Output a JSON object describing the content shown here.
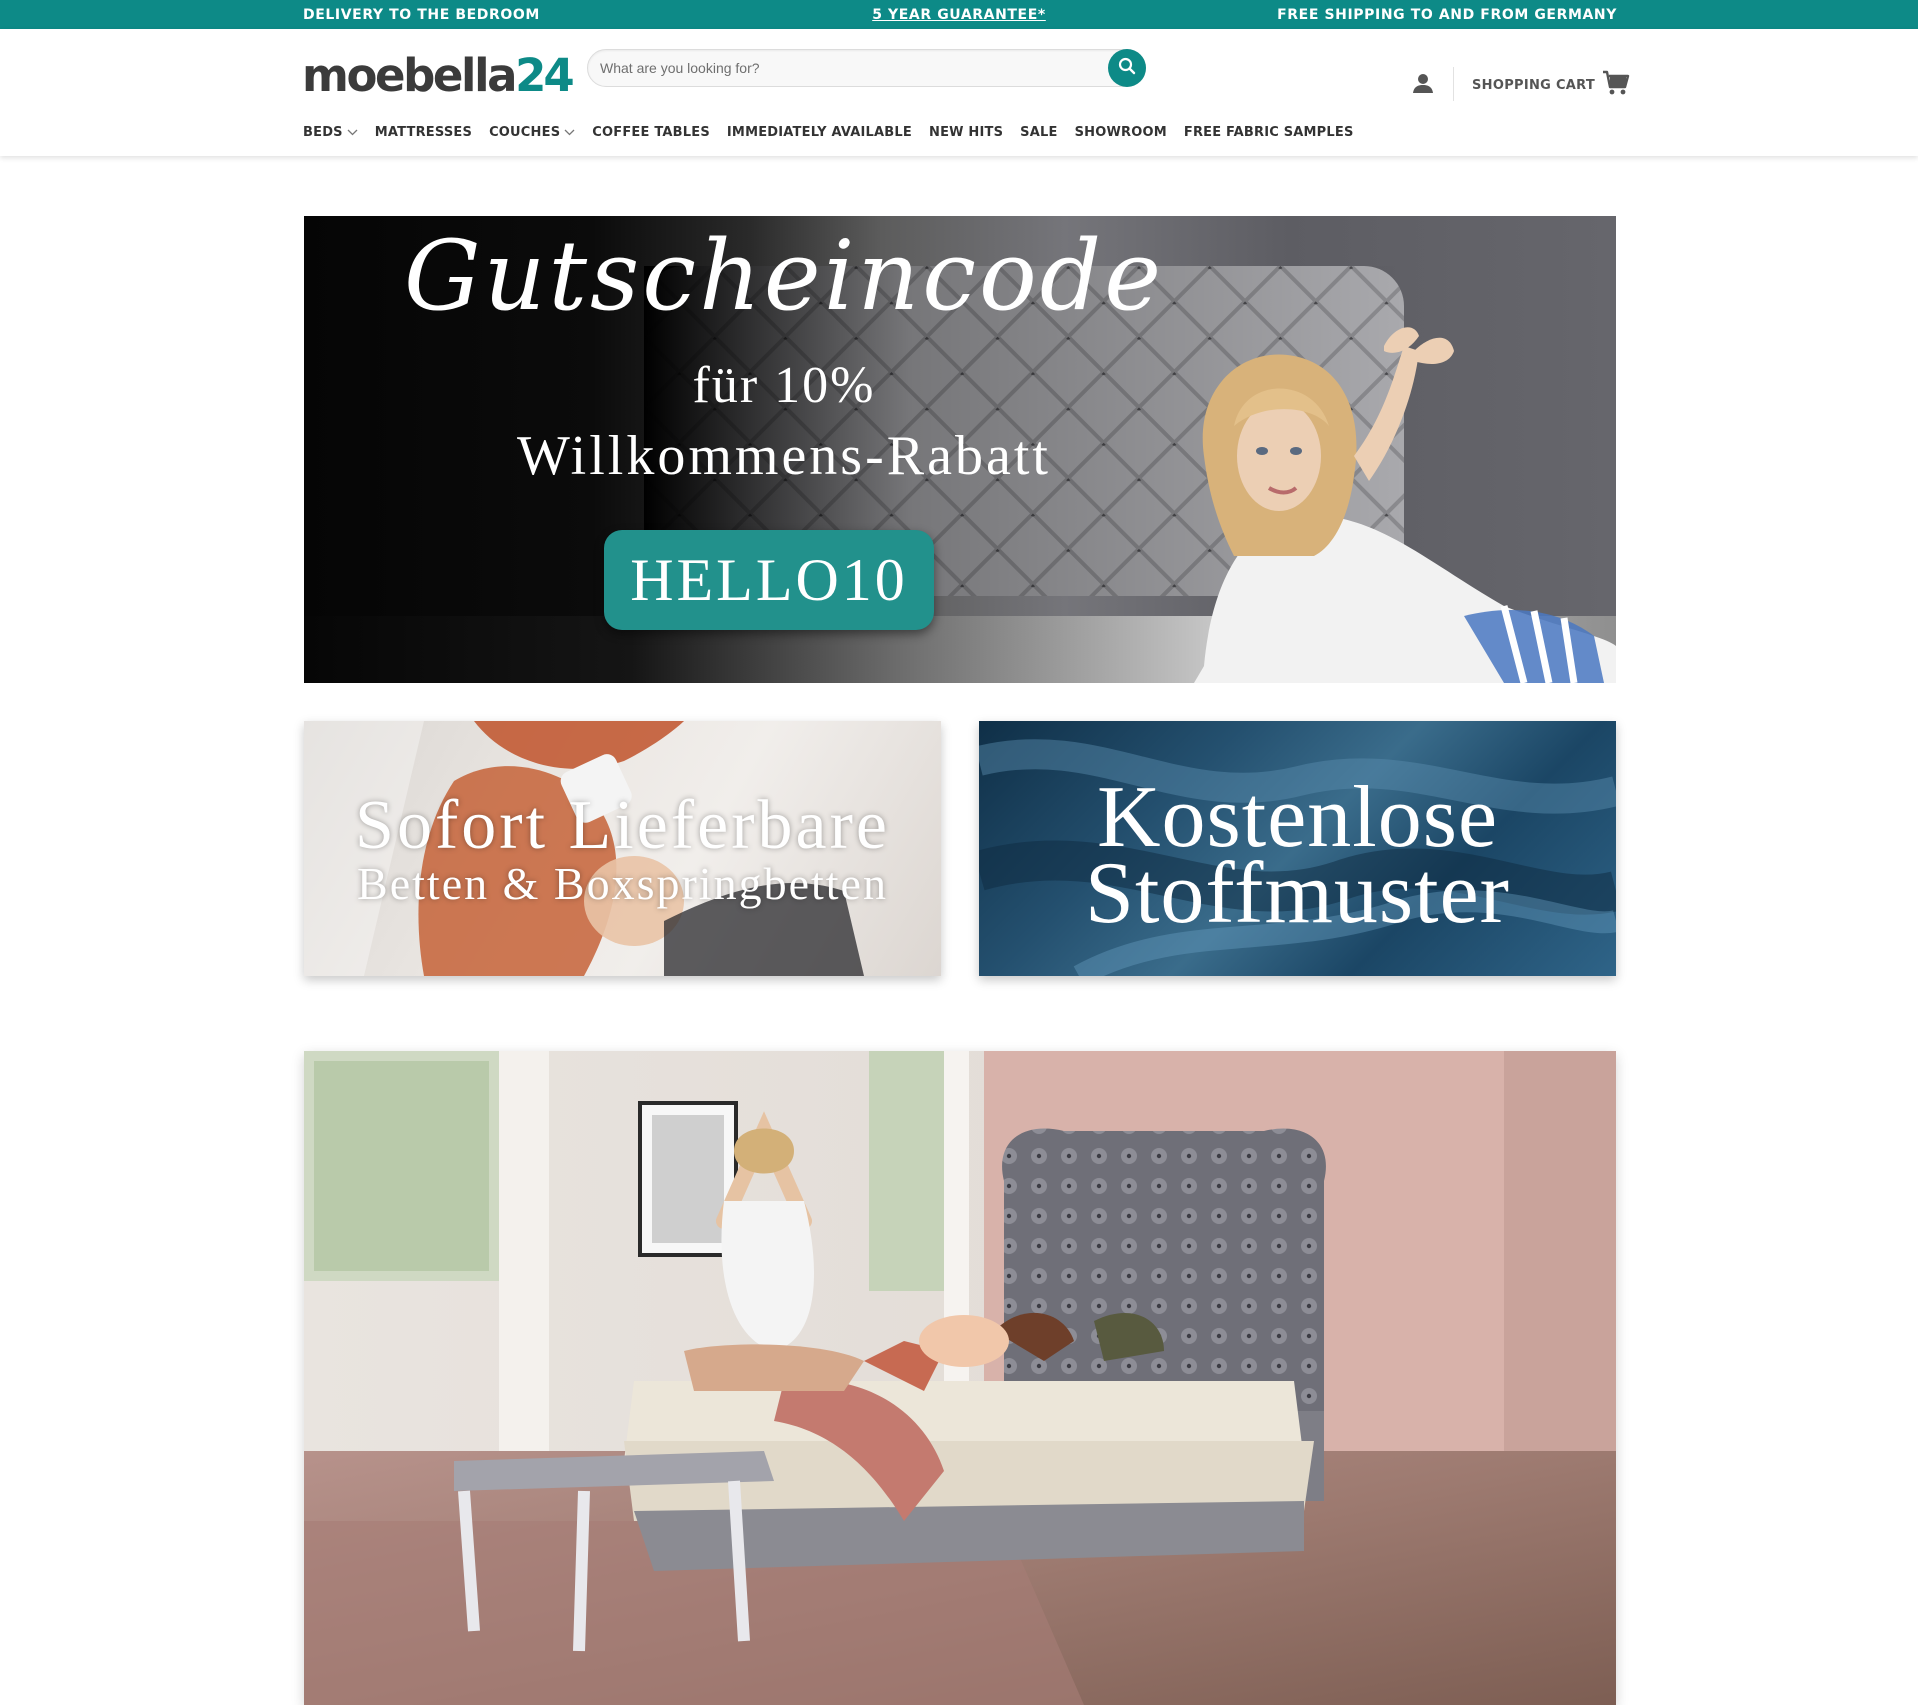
{
  "topbar": {
    "left": "DELIVERY TO THE BEDROOM",
    "center": "5 YEAR GUARANTEE*",
    "right": "FREE SHIPPING TO AND FROM GERMANY"
  },
  "header": {
    "logo_main": "moebella",
    "logo_num": "24",
    "search_placeholder": "What are you looking for?",
    "cart_label": "SHOPPING CART"
  },
  "nav": {
    "items": [
      "BEDS",
      "MATTRESSES",
      "COUCHES",
      "COFFEE TABLES",
      "IMMEDIATELY AVAILABLE",
      "NEW HITS",
      "SALE",
      "SHOWROOM",
      "FREE FABRIC SAMPLES"
    ]
  },
  "hero": {
    "line1": "Gutscheincode",
    "line2": "für 10%",
    "line3": "Willkommens-Rabatt",
    "code": "HELLO10"
  },
  "promo_left": {
    "line1": "Sofort Lieferbare",
    "line2": "Betten & Boxspringbetten"
  },
  "promo_right": {
    "line1": "Kostenlose",
    "line2": "Stoffmuster"
  },
  "colors": {
    "brand_teal": "#0d8a87",
    "code_button": "#22918c",
    "text_dark": "#333333"
  },
  "icons": {
    "search": "search-icon",
    "account": "user-icon",
    "cart": "cart-icon",
    "dropdown": "chevron-down-icon"
  }
}
